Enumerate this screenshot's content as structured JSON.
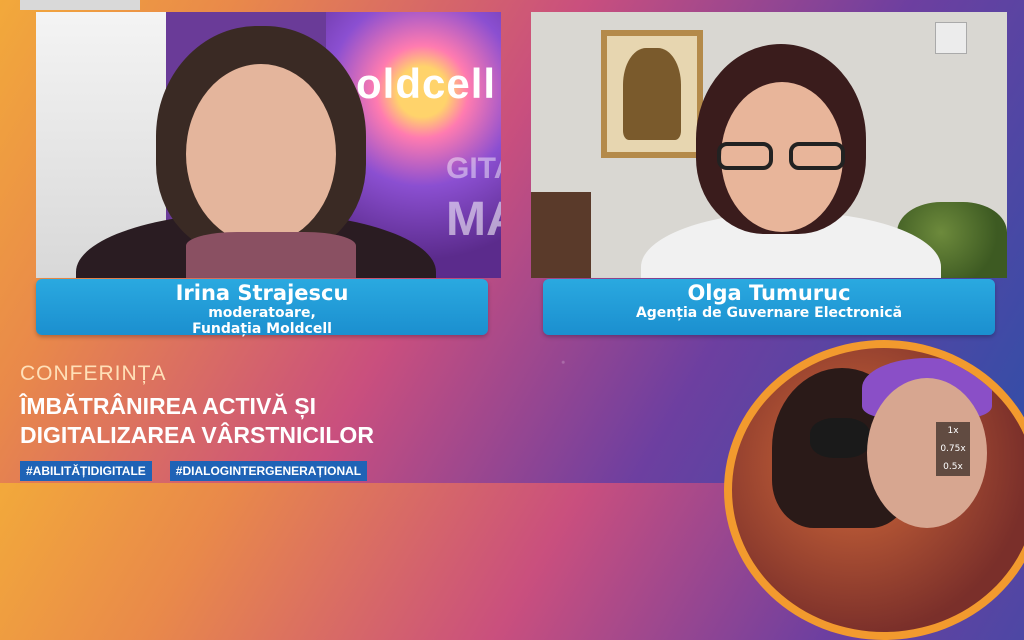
{
  "participants": [
    {
      "name": "Irina Strajescu",
      "role": "moderatoare,",
      "organization": "Fundația Moldcell"
    },
    {
      "name": "Olga Tumuruc",
      "organization": "Agenția de Guvernare Electronică"
    }
  ],
  "background_banner": {
    "logo_text": "oldcell",
    "fragment_mid": "GITAL",
    "fragment_big": "MA"
  },
  "conference": {
    "label": "CONFERINȚA",
    "title_line1": "ÎMBĂTRÂNIREA ACTIVĂ ȘI",
    "title_line2": "DIGITALIZAREA VÂRSTNICILOR",
    "tags": [
      "#ABILITĂȚIDIGITALE",
      "#DIALOGINTERGENERAȚIONAL"
    ]
  },
  "playback_speeds": [
    "1x",
    "0.75x",
    "0.5x"
  ],
  "colors": {
    "name_card": "#1b8fcf",
    "tag_background": "#1f63b6",
    "accent_orange": "#f29a2e"
  }
}
